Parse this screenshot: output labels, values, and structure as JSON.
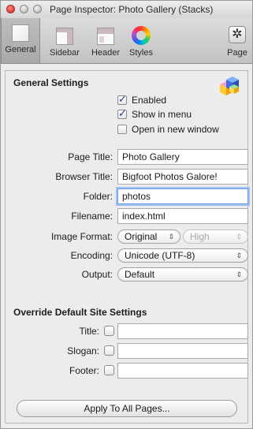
{
  "window": {
    "title": "Page Inspector: Photo Gallery (Stacks)"
  },
  "toolbar": {
    "tabs": [
      {
        "label": "General",
        "icon": "general-page-icon",
        "selected": true
      },
      {
        "label": "Sidebar",
        "icon": "sidebar-layout-icon",
        "selected": false
      },
      {
        "label": "Header",
        "icon": "header-layout-icon",
        "selected": false
      },
      {
        "label": "Styles",
        "icon": "color-wheel-icon",
        "selected": false
      },
      {
        "label": "Page",
        "icon": "gear-icon",
        "selected": false
      }
    ]
  },
  "general": {
    "heading": "General Settings",
    "enabled": {
      "label": "Enabled",
      "checked": true
    },
    "show_in_menu": {
      "label": "Show in menu",
      "checked": true
    },
    "open_new_window": {
      "label": "Open in new window",
      "checked": false
    },
    "page_title": {
      "label": "Page Title:",
      "value": "Photo Gallery"
    },
    "browser_title": {
      "label": "Browser Title:",
      "value": "Bigfoot Photos Galore!"
    },
    "folder": {
      "label": "Folder:",
      "value": "photos"
    },
    "filename": {
      "label": "Filename:",
      "value": "index.html"
    },
    "image_format": {
      "label": "Image Format:",
      "value": "Original",
      "quality": "High"
    },
    "encoding": {
      "label": "Encoding:",
      "value": "Unicode (UTF-8)"
    },
    "output": {
      "label": "Output:",
      "value": "Default"
    }
  },
  "override": {
    "heading": "Override Default Site Settings",
    "title": {
      "label": "Title:",
      "checked": false,
      "value": ""
    },
    "slogan": {
      "label": "Slogan:",
      "checked": false,
      "value": ""
    },
    "footer": {
      "label": "Footer:",
      "checked": false,
      "value": ""
    }
  },
  "apply_button": {
    "label": "Apply To All Pages..."
  }
}
